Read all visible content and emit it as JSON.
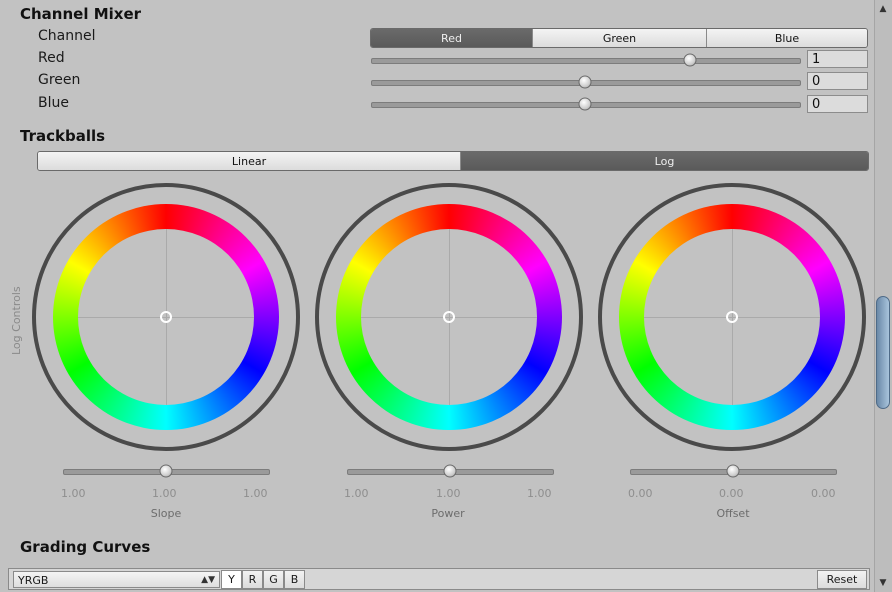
{
  "channel_mixer": {
    "title": "Channel Mixer",
    "channel_label": "Channel",
    "channel_options": [
      "Red",
      "Green",
      "Blue"
    ],
    "channel_selected": 0,
    "rows": [
      {
        "label": "Red",
        "value": "1",
        "slider_fraction": 0.74
      },
      {
        "label": "Green",
        "value": "0",
        "slider_fraction": 0.5
      },
      {
        "label": "Blue",
        "value": "0",
        "slider_fraction": 0.5
      }
    ]
  },
  "trackballs": {
    "title": "Trackballs",
    "mode_options": [
      "Linear",
      "Log"
    ],
    "mode_selected": 1,
    "side_label": "Log Controls",
    "wheels": [
      {
        "label": "Slope",
        "values": [
          "1.00",
          "1.00",
          "1.00"
        ],
        "slider_fraction": 0.5
      },
      {
        "label": "Power",
        "values": [
          "1.00",
          "1.00",
          "1.00"
        ],
        "slider_fraction": 0.5
      },
      {
        "label": "Offset",
        "values": [
          "0.00",
          "0.00",
          "0.00"
        ],
        "slider_fraction": 0.5
      }
    ]
  },
  "grading_curves": {
    "title": "Grading Curves",
    "curve_select": "YRGB",
    "channels": [
      "Y",
      "R",
      "G",
      "B"
    ],
    "channel_selected": 0,
    "reset_label": "Reset"
  },
  "icons": {
    "select_arrow": "up-down-arrows-icon",
    "scroll_up": "scroll-up-arrow-icon",
    "scroll_down": "scroll-down-arrow-icon"
  }
}
